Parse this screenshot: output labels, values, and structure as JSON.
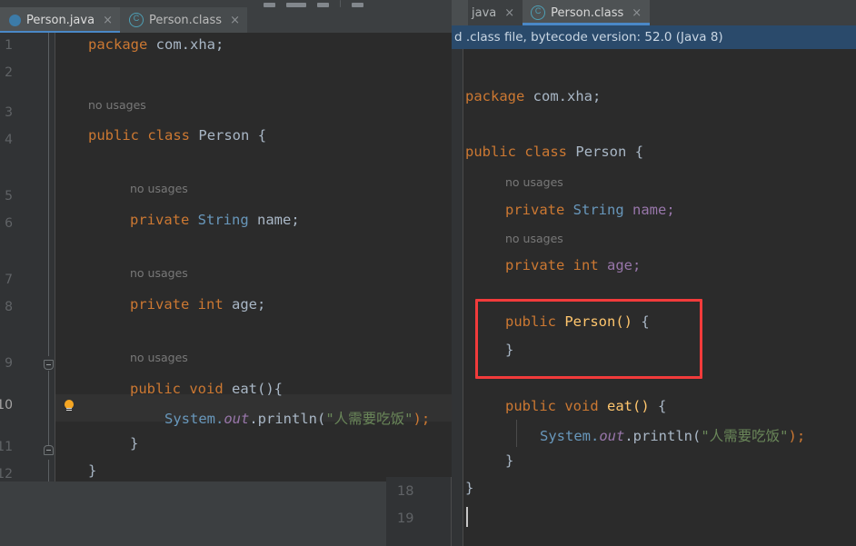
{
  "left_window": {
    "toolbar": {
      "icons": [
        "toolbar-icon-1",
        "toolbar-icon-2",
        "toolbar-icon-3",
        "toolbar-separator",
        "toolbar-icon-4"
      ]
    },
    "tabs": [
      {
        "label": "Person.java",
        "icon": "java-file-icon",
        "close": "×",
        "active": true
      },
      {
        "label": "Person.class",
        "icon": "class-file-icon",
        "close": "×",
        "active": false
      }
    ],
    "line_numbers": [
      "1",
      "2",
      "3",
      "4",
      "5",
      "6",
      "7",
      "8",
      "9",
      "10",
      "11",
      "12"
    ],
    "current_line": "10",
    "code_lines": [
      {
        "n": "1",
        "text": "package com.xha;"
      },
      {
        "n": "3",
        "text": "public class Person {"
      },
      {
        "n": "5",
        "text": "    private String name;"
      },
      {
        "n": "7",
        "text": "    private int age;"
      },
      {
        "n": "9",
        "text": "    public void eat(){"
      },
      {
        "n": "10",
        "text": "        System.out.println(\"人需要吃饭\");"
      },
      {
        "n": "11",
        "text": "    }"
      },
      {
        "n": "12",
        "text": "}"
      }
    ],
    "usage_hints": [
      "no usages",
      "no usages",
      "no usages",
      "no usages"
    ],
    "tokens": {
      "package": "package",
      "pkg_name": "com.xha;",
      "public": "public",
      "class": "class",
      "person": "Person",
      "brace_open": "{",
      "brace_close": "}",
      "private": "private",
      "string_type": "String",
      "name_field": "name;",
      "int_type": "int",
      "age_field": "age;",
      "void": "void",
      "eat_sig": "eat(){",
      "system": "System.",
      "out": "out",
      "println_open": ".println(",
      "cn_string": "\"人需要吃饭\"",
      "paren_semi": ");",
      "indent_close": "    }"
    },
    "gutter_icons": {
      "bulb": "lightbulb-icon",
      "fold_open": "fold-open-icon",
      "fold_close": "fold-close-icon"
    }
  },
  "right_window": {
    "tabs": [
      {
        "label": "java",
        "close": "×",
        "active": false,
        "truncated": true
      },
      {
        "label": "Person.class",
        "icon": "class-file-icon",
        "close": "×",
        "active": true
      }
    ],
    "banner": "d .class file, bytecode version: 52.0 (Java 8)",
    "gutter": {
      "line_numbers": [
        "18",
        "19"
      ]
    },
    "code_lines": [
      {
        "text": "package com.xha;"
      },
      {
        "text": "public class Person {"
      },
      {
        "text": "    no usages"
      },
      {
        "text": "    private String name;"
      },
      {
        "text": "    no usages"
      },
      {
        "text": "    private int age;"
      },
      {
        "text": "    public Person() {"
      },
      {
        "text": "    }"
      },
      {
        "text": "    public void eat() {"
      },
      {
        "text": "        System.out.println(\"人需要吃饭\");"
      },
      {
        "text": "    }"
      },
      {
        "text": "}"
      }
    ],
    "usage_hints": [
      "no usages",
      "no usages"
    ],
    "tokens": {
      "package": "package",
      "pkg_name": "com.xha;",
      "public": "public",
      "class": "class",
      "person": "Person",
      "brace_open": "{",
      "brace_close": "}",
      "private": "private",
      "string_type": "String",
      "name_field": "name;",
      "int_type": "int",
      "age_field": "age;",
      "ctor_name": "Person()",
      "ctor_brace": "{",
      "void": "void",
      "eat_name": "eat()",
      "eat_brace": "{",
      "system": "System.",
      "out": "out",
      "println_open": ".println(",
      "cn_string": "\"人需要吃饭\"",
      "paren_semi": ");",
      "indent_close": "    }"
    },
    "annotation": {
      "type": "red-rectangle-highlight",
      "color": "#f23b3b",
      "target": "default constructor"
    }
  },
  "colors": {
    "keyword": "#cc7832",
    "field": "#9876aa",
    "type": "#6897bb",
    "string": "#6a8759",
    "method": "#ffc66d",
    "plain": "#a9b7c6",
    "accent": "#4a88c7",
    "highlight": "#f23b3b",
    "editor_bg": "#2b2b2b",
    "chrome_bg": "#3c3f41",
    "banner_bg": "#2a4a6b"
  }
}
